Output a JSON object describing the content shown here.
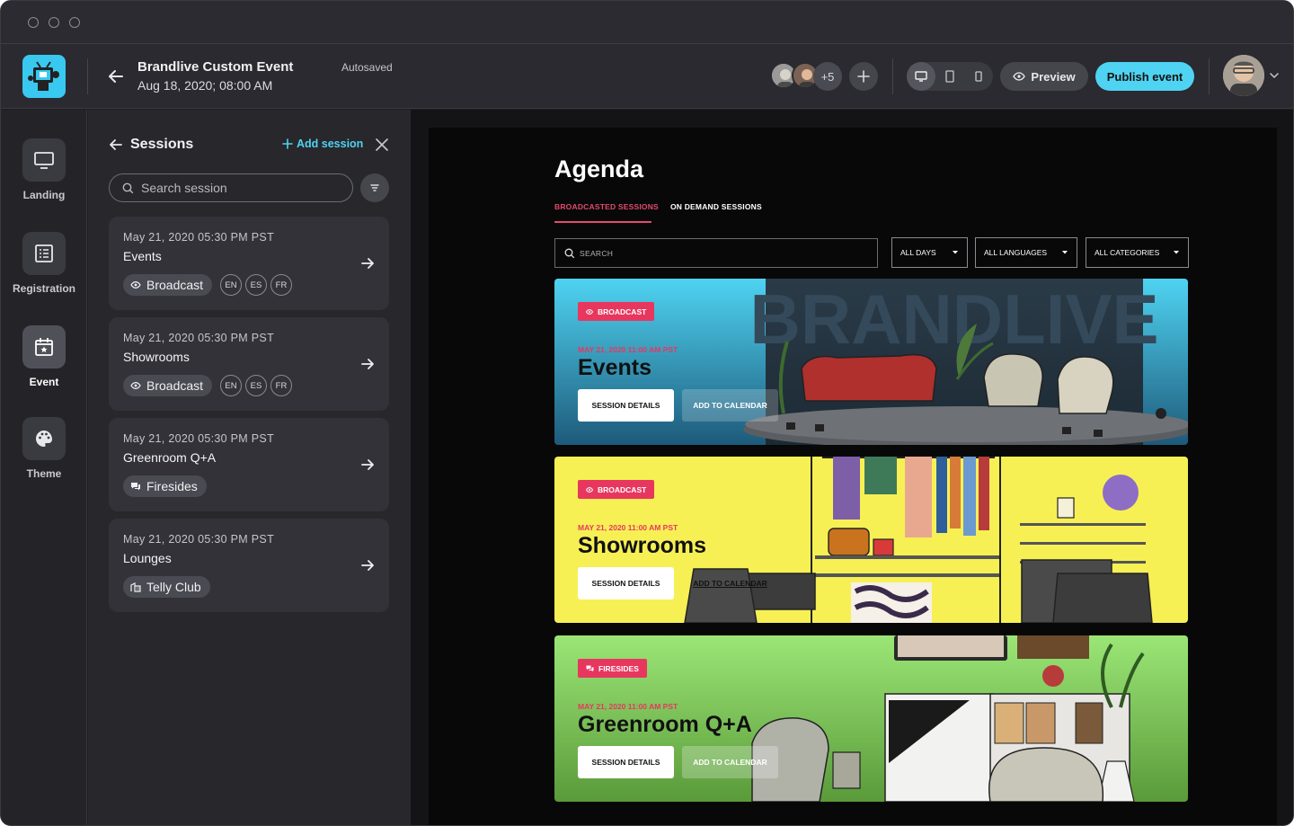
{
  "header": {
    "event_title": "Brandlive Custom Event",
    "event_date": "Aug 18, 2020; 08:00 AM",
    "autosave_status": "Autosaved",
    "collaborators_more": "+5",
    "preview_label": "Preview",
    "publish_label": "Publish event"
  },
  "nav": {
    "items": [
      {
        "label": "Landing",
        "icon": "monitor-icon"
      },
      {
        "label": "Registration",
        "icon": "list-icon"
      },
      {
        "label": "Event",
        "icon": "calendar-icon"
      },
      {
        "label": "Theme",
        "icon": "palette-icon"
      }
    ],
    "active": "Event"
  },
  "sessions_panel": {
    "title": "Sessions",
    "add_label": "Add session",
    "search_placeholder": "Search session",
    "sessions": [
      {
        "date": "May 21, 2020 05:30 PM PST",
        "name": "Events",
        "tag": "Broadcast",
        "tag_icon": "eye-icon",
        "languages": [
          "EN",
          "ES",
          "FR"
        ]
      },
      {
        "date": "May 21, 2020 05:30 PM PST",
        "name": "Showrooms",
        "tag": "Broadcast",
        "tag_icon": "eye-icon",
        "languages": [
          "EN",
          "ES",
          "FR"
        ]
      },
      {
        "date": "May 21, 2020 05:30 PM PST",
        "name": "Greenroom Q+A",
        "tag": "Firesides",
        "tag_icon": "chat-icon",
        "languages": []
      },
      {
        "date": "May 21, 2020 05:30 PM PST",
        "name": "Lounges",
        "tag": "Telly Club",
        "tag_icon": "building-icon",
        "languages": []
      }
    ]
  },
  "agenda": {
    "title": "Agenda",
    "tabs": [
      "BROADCASTED SESSIONS",
      "ON DEMAND SESSIONS"
    ],
    "active_tab": "BROADCASTED SESSIONS",
    "search_placeholder": "SEARCH",
    "filters": [
      "ALL DAYS",
      "ALL LANGUAGES",
      "ALL CATEGORIES"
    ],
    "cards": [
      {
        "tag": "BROADCAST",
        "date": "MAY 21, 2020 11:00 AM PST",
        "title": "Events",
        "details_label": "SESSION DETAILS",
        "calendar_label": "ADD TO CALENDAR",
        "backdrop_text": "BRANDLIVE",
        "theme_color": "#4fd3f2"
      },
      {
        "tag": "BROADCAST",
        "date": "MAY 21, 2020 11:00 AM PST",
        "title": "Showrooms",
        "details_label": "SESSION DETAILS",
        "calendar_label": "ADD TO CALENDAR",
        "theme_color": "#f6f055"
      },
      {
        "tag": "FIRESIDES",
        "date": "MAY 21, 2020 11:00 AM PST",
        "title": "Greenroom Q+A",
        "details_label": "SESSION DETAILS",
        "calendar_label": "ADD TO CALENDAR",
        "theme_color": "#8fe06a"
      }
    ]
  },
  "colors": {
    "accent": "#4fd3f2",
    "tag_red": "#e8375f",
    "bg": "#1f1f23"
  }
}
